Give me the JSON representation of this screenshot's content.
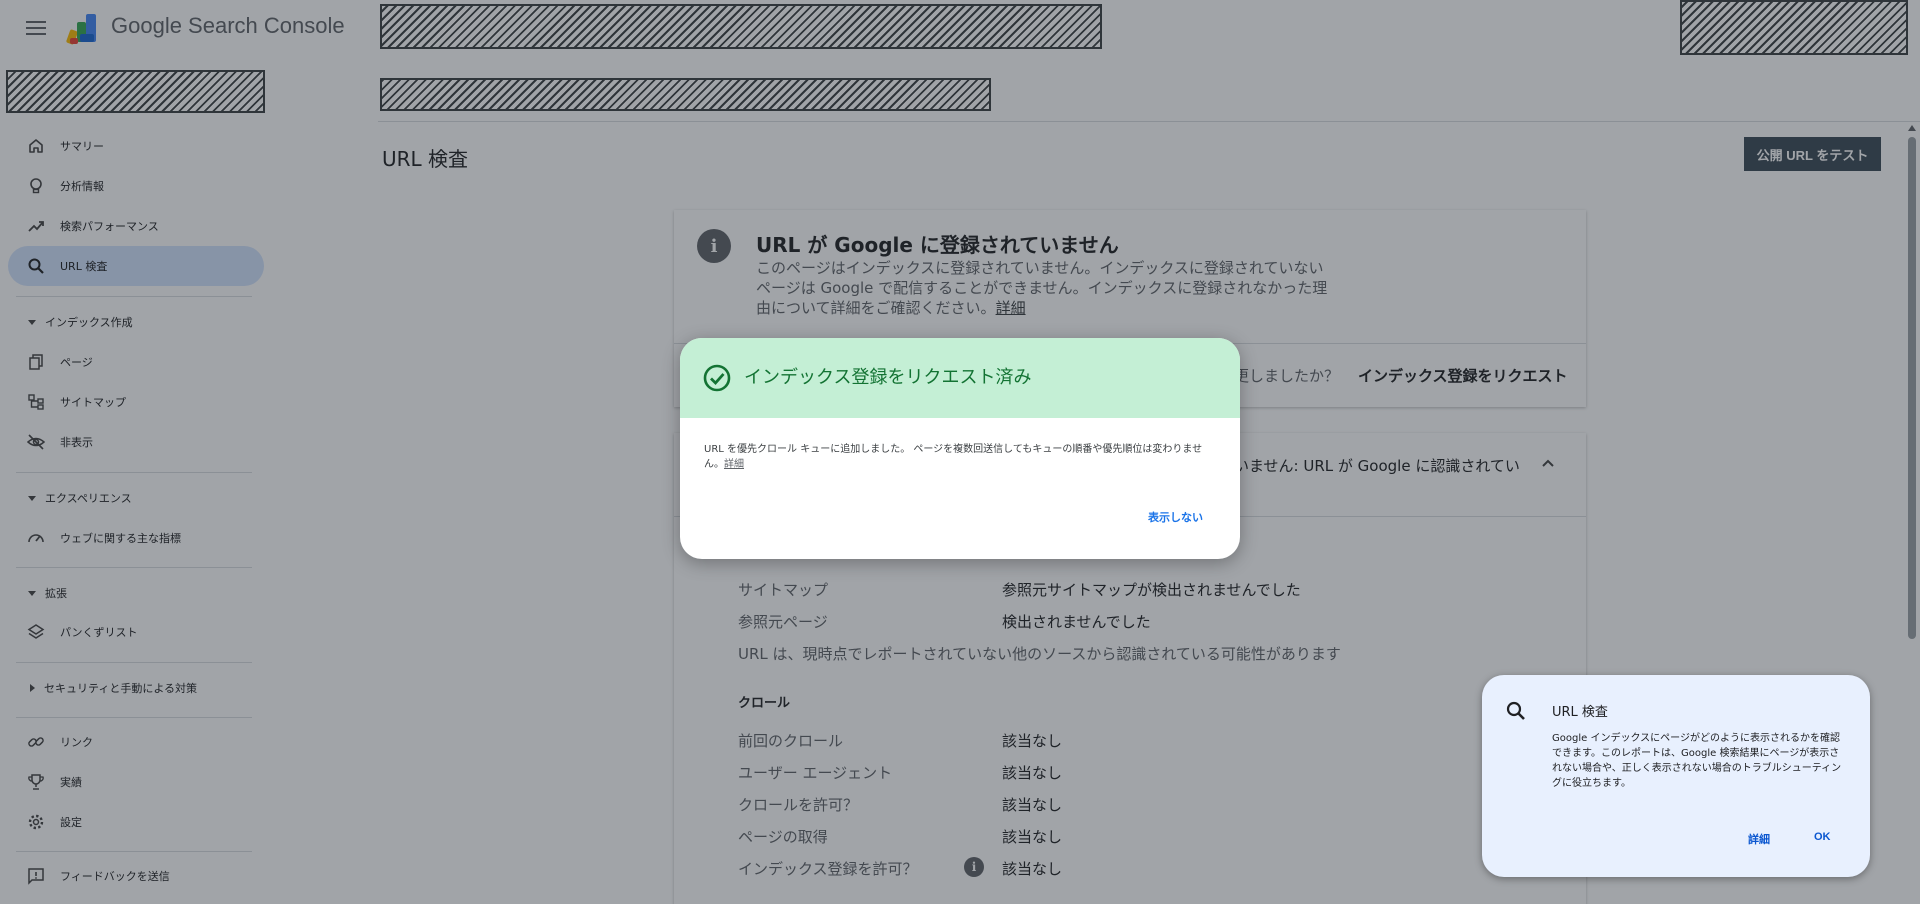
{
  "app": {
    "name": "Google Search Console"
  },
  "sidebar": {
    "items": [
      {
        "label": "サマリー"
      },
      {
        "label": "分析情報"
      },
      {
        "label": "検索パフォーマンス"
      },
      {
        "label": "URL 検査"
      },
      {
        "label": "ページ"
      },
      {
        "label": "サイトマップ"
      },
      {
        "label": "非表示"
      },
      {
        "label": "ウェブに関する主な指標"
      },
      {
        "label": "パンくずリスト"
      },
      {
        "label": "リンク"
      },
      {
        "label": "実績"
      },
      {
        "label": "設定"
      },
      {
        "label": "フィードバックを送信"
      }
    ],
    "sections": [
      {
        "label": "インデックス作成"
      },
      {
        "label": "エクスペリエンス"
      },
      {
        "label": "拡張"
      },
      {
        "label": "セキュリティと手動による対策"
      }
    ]
  },
  "main": {
    "title": "URL 検査",
    "test_button": "公開 URL をテスト",
    "status": {
      "title": "URL が Google に登録されていません",
      "description": "このページはインデックスに登録されていません。インデックスに登録されていないページは Google で配信することができません。インデックスに登録されなかった理由について詳細をご確認ください。",
      "link": "詳細",
      "question": "更しましたか？",
      "request_button": "インデックス登録をリクエスト"
    },
    "coverage": {
      "header": "いません: URL が Google に認識されてい"
    },
    "discovery": [
      {
        "label": "サイトマップ",
        "value": "参照元サイトマップが検出されませんでした"
      },
      {
        "label": "参照元ページ",
        "value": "検出されませんでした"
      }
    ],
    "discovery_note": "URL は、現時点でレポートされていない他のソースから認識されている可能性があります",
    "crawl": {
      "heading": "クロール",
      "rows": [
        {
          "label": "前回のクロール",
          "value": "該当なし"
        },
        {
          "label": "ユーザー エージェント",
          "value": "該当なし"
        },
        {
          "label": "クロールを許可？",
          "value": "該当なし"
        },
        {
          "label": "ページの取得",
          "value": "該当なし"
        },
        {
          "label": "インデックス登録を許可？",
          "value": "該当なし"
        }
      ]
    }
  },
  "dialog": {
    "title": "インデックス登録をリクエスト済み",
    "body": "URL を優先クロール キューに追加しました。 ページを複数回送信してもキューの順番や優先順位は変わりません。",
    "link": "詳細",
    "dismiss": "表示しない"
  },
  "tip": {
    "title": "URL 検査",
    "body": "Google インデックスにページがどのように表示されるかを確認できます。このレポートは、Google 検索結果にページが表示されない場合や、正しく表示されない場合のトラブルシューティングに役立ちます。",
    "detail_button": "詳細",
    "ok_button": "OK"
  },
  "colors": {
    "dialog_header": "#c4efd5",
    "dialog_title": "#137333",
    "active_nav": "#d3e3fd",
    "primary_button": "#3c4a56",
    "link": "#1a73e8"
  }
}
